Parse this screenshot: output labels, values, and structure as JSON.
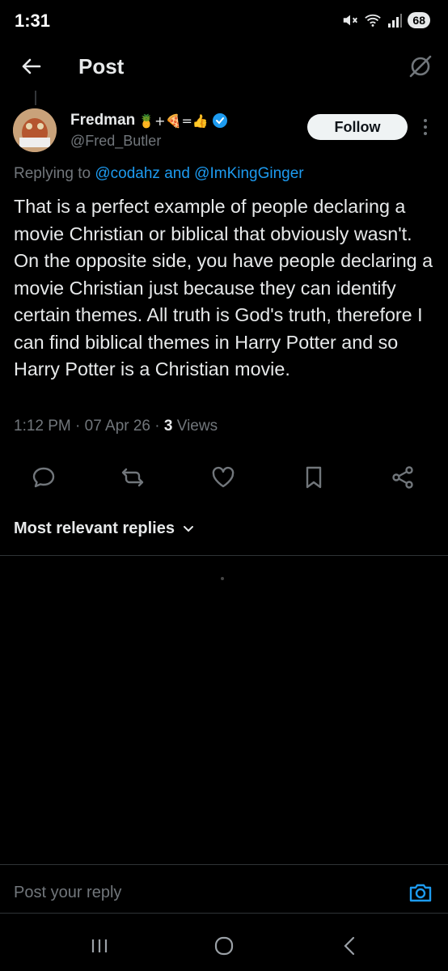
{
  "status_bar": {
    "time": "1:31",
    "battery": "68"
  },
  "header": {
    "title": "Post"
  },
  "post": {
    "author_name": "Fredman",
    "name_emojis": "🍍+🍕=👍",
    "handle": "@Fred_Butler",
    "follow_label": "Follow",
    "replying_prefix": "Replying to",
    "replying_to_1": "@codahz",
    "replying_join": "and",
    "replying_to_2": "@ImKingGinger",
    "text": "That is a perfect example of people declaring a movie Christian or biblical that obviously wasn't. On the opposite side, you have people declaring a movie Christian just because they can identify certain themes. All truth is God's truth, therefore I can find biblical themes in Harry Potter and so Harry Potter is a Christian movie.",
    "time": "1:12 PM",
    "date": "07 Apr 26",
    "views_count": "3",
    "views_label": "Views"
  },
  "replies": {
    "sort_label": "Most relevant replies"
  },
  "composer": {
    "placeholder": "Post your reply"
  },
  "colors": {
    "accent": "#1d9bf0",
    "background": "#000000",
    "muted": "#71767b"
  }
}
